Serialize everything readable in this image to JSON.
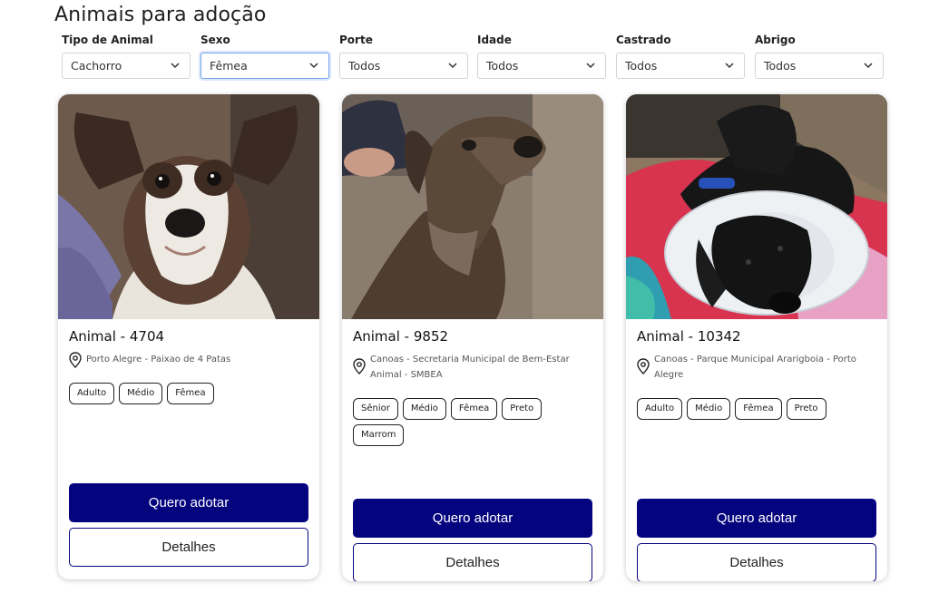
{
  "page": {
    "title": "Animais para adoção"
  },
  "filters": [
    {
      "label": "Tipo de Animal",
      "value": "Cachorro"
    },
    {
      "label": "Sexo",
      "value": "Fêmea"
    },
    {
      "label": "Porte",
      "value": "Todos"
    },
    {
      "label": "Idade",
      "value": "Todos"
    },
    {
      "label": "Castrado",
      "value": "Todos"
    },
    {
      "label": "Abrigo",
      "value": "Todos"
    }
  ],
  "cards": [
    {
      "title": "Animal - 4704",
      "location": "Porto Alegre - Paixao de 4 Patas",
      "tags": [
        "Adulto",
        "Médio",
        "Fêmea"
      ],
      "adopt_label": "Quero adotar",
      "details_label": "Detalhes",
      "photo": "brindle-white-dog-photo"
    },
    {
      "title": "Animal - 9852",
      "location": "Canoas - Secretaria Municipal de Bem-Estar Animal - SMBEA",
      "tags": [
        "Sênior",
        "Médio",
        "Fêmea",
        "Preto",
        "Marrom"
      ],
      "adopt_label": "Quero adotar",
      "details_label": "Detalhes",
      "photo": "senior-dark-dog-photo"
    },
    {
      "title": "Animal - 10342",
      "location": "Canoas - Parque Municipal Ararigboia - Porto Alegre",
      "tags": [
        "Adulto",
        "Médio",
        "Fêmea",
        "Preto"
      ],
      "adopt_label": "Quero adotar",
      "details_label": "Detalhes",
      "photo": "black-dog-with-cone-photo"
    }
  ],
  "colors": {
    "primary": "#05047f",
    "focus": "#7aa5e8"
  }
}
